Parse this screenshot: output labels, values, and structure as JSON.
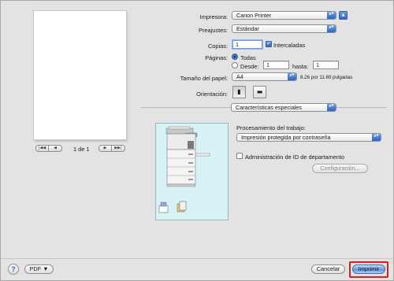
{
  "preview": {
    "page_indicator": "1 de 1",
    "first_glyph": "|◀◀",
    "prev_glyph": "◀",
    "next_glyph": "▶",
    "last_glyph": "▶▶|"
  },
  "printer": {
    "label": "Impresora:",
    "value": "Canon Printer",
    "expand_glyph": "▲"
  },
  "presets": {
    "label": "Preajustes:",
    "value": "Estándar"
  },
  "copies": {
    "label": "Copias:",
    "value": "1",
    "collated_label": "Intercaladas",
    "collated_checked": true
  },
  "pages": {
    "label": "Páginas:",
    "all_label": "Todas",
    "from_label": "Desde:",
    "from_value": "1",
    "to_label": "hasta:",
    "to_value": "1",
    "selected": "all"
  },
  "paper_size": {
    "label": "Tamaño del papel:",
    "value": "A4",
    "dimensions": "8.26 por 11.69 pulgadas"
  },
  "orientation": {
    "label": "Orientación:",
    "portrait_glyph": "▮",
    "landscape_glyph": "▬"
  },
  "section_popup": {
    "value": "Características especiales"
  },
  "job": {
    "label": "Procesamiento del trabajo:",
    "value": "Impresión protegida por contraseña"
  },
  "department": {
    "label": "Administración de ID de departamento",
    "checked": false
  },
  "config_button": {
    "label": "Configuración..."
  },
  "footer": {
    "help_glyph": "?",
    "pdf_label": "PDF ▼",
    "cancel_label": "Cancelar",
    "print_label": "Imprimir"
  },
  "colors": {
    "accent_blue": "#2d64c8",
    "highlight_red": "#d52020",
    "printer_panel_bg": "#d8f3f6"
  },
  "popup_arrows": "▲▼"
}
